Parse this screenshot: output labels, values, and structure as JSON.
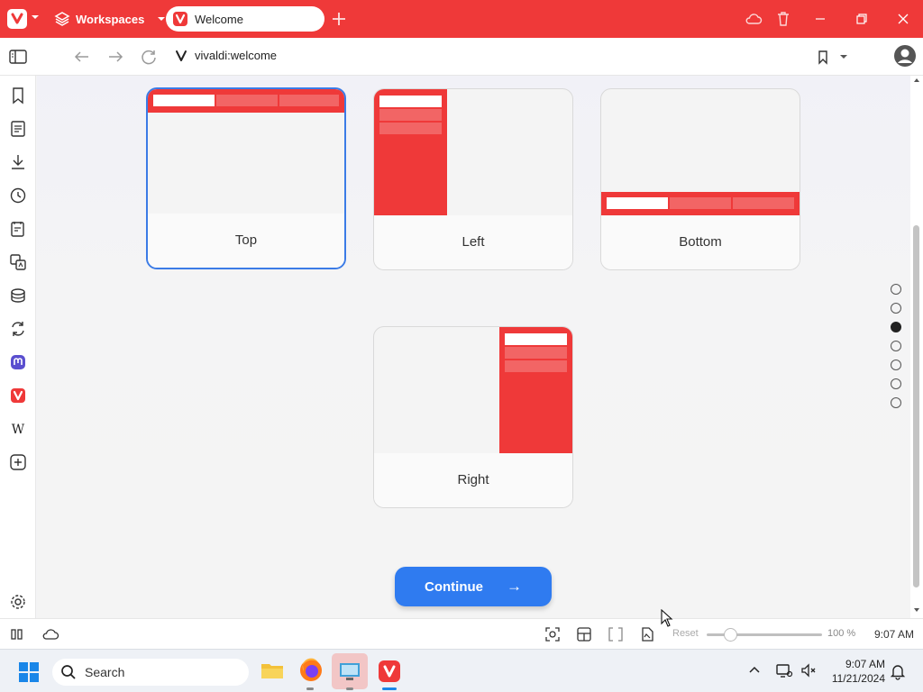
{
  "titlebar": {
    "workspaces_label": "Workspaces",
    "tab_title": "Welcome",
    "accent": "#ef3939"
  },
  "addressbar": {
    "url": "vivaldi:welcome"
  },
  "sidepanel": {
    "icons": [
      "bookmarks-icon",
      "reading-list-icon",
      "downloads-icon",
      "history-icon",
      "notes-icon",
      "translate-icon",
      "window-panel-icon",
      "sync-icon",
      "mastodon-icon",
      "vivaldi-icon",
      "wikipedia-icon",
      "add-panel-icon",
      "settings-icon"
    ]
  },
  "layout_options": [
    {
      "label": "Top",
      "selected": true
    },
    {
      "label": "Left",
      "selected": false
    },
    {
      "label": "Bottom",
      "selected": false
    },
    {
      "label": "Right",
      "selected": false
    }
  ],
  "continue_label": "Continue",
  "continue_arrow": "→",
  "pager": {
    "count": 7,
    "active_index": 2
  },
  "statusbar": {
    "reset_label": "Reset",
    "zoom": "100 %",
    "clock": "9:07 AM"
  },
  "taskbar": {
    "search_placeholder": "Search",
    "time": "9:07 AM",
    "date": "11/21/2024"
  }
}
